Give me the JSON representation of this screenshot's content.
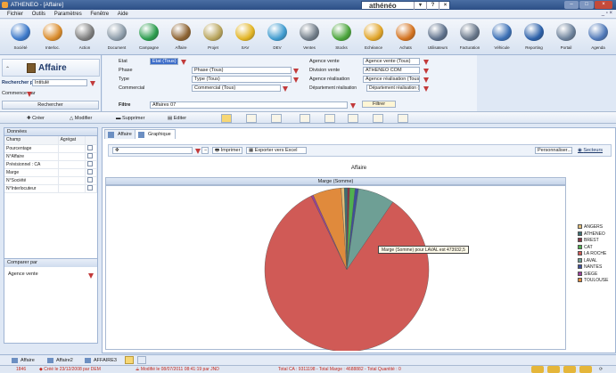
{
  "app": {
    "title": "ATHENEO - [Affaire]",
    "brand": "athénéo"
  },
  "menu": [
    "Fichier",
    "Outils",
    "Paramètres",
    "Fenêtre",
    "Aide"
  ],
  "toolbar": [
    {
      "label": "Société",
      "icon": "building-icon",
      "color": "#3b78c9"
    },
    {
      "label": "Interloc.",
      "icon": "people-icon",
      "color": "#d98b2b"
    },
    {
      "label": "Action",
      "icon": "action-icon",
      "color": "#7d7d7d"
    },
    {
      "label": "Document",
      "icon": "document-icon",
      "color": "#8b9aa8"
    },
    {
      "label": "Campagne",
      "icon": "campaign-icon",
      "color": "#2b9c4d"
    },
    {
      "label": "Affaire",
      "icon": "affaire-icon",
      "color": "#8d6332"
    },
    {
      "label": "Projet",
      "icon": "projet-icon",
      "color": "#b8a45c"
    },
    {
      "label": "SAV",
      "icon": "sav-icon",
      "color": "#e2b423"
    },
    {
      "label": "DEV",
      "icon": "dev-icon",
      "color": "#3f9bcf"
    },
    {
      "label": "Ventes",
      "icon": "ventes-icon",
      "color": "#6f7b87"
    },
    {
      "label": "Stocks",
      "icon": "stocks-icon",
      "color": "#4aa43a"
    },
    {
      "label": "Echéance",
      "icon": "echeance-icon",
      "color": "#e0a428"
    },
    {
      "label": "Achats",
      "icon": "achats-icon",
      "color": "#d3721f"
    },
    {
      "label": "Utilisateurs",
      "icon": "users-icon",
      "color": "#5c6f8a"
    },
    {
      "label": "Facturation",
      "icon": "facturation-icon",
      "color": "#657488"
    },
    {
      "label": "Véhicule",
      "icon": "vehicle-icon",
      "color": "#3b6fb5"
    },
    {
      "label": "Reporting",
      "icon": "reporting-icon",
      "color": "#2b5fa8"
    },
    {
      "label": "Portail",
      "icon": "portail-icon",
      "color": "#6a7f99"
    },
    {
      "label": "Agenda",
      "icon": "agenda-icon",
      "color": "#4f78b8"
    }
  ],
  "left": {
    "title": "Affaire",
    "rechercher_par_label": "Rechercher par",
    "rechercher_par_value": "Intitulé",
    "commence_par_label": "Commence par",
    "commence_par_value": "",
    "rechercher_button": "Rechercher"
  },
  "filters": {
    "etat_label": "Etat",
    "etat_value": "Etat (Tous)",
    "phase_label": "Phase",
    "phase_value": "Phase (Tous)",
    "type_label": "Type",
    "type_value": "Type (Tous)",
    "commercial_label": "Commercial",
    "commercial_value": "Commercial (Tous)",
    "agence_vente_label": "Agence vente",
    "agence_vente_value": "Agence vente (Tous)",
    "division_label": "Division vente",
    "division_value": "ATHENEO COM",
    "agence_real_label": "Agence réalisation",
    "agence_real_value": "Agence réalisation (Tous)",
    "dept_label": "Département réalisation",
    "dept_value": "Département réalisation (Tous)",
    "filtre_label": "Filtre",
    "filtre_value": "Affaires 07",
    "filtrer_button": "Filtrer"
  },
  "actions": {
    "creer": "Créer",
    "modifier": "Modifier",
    "supprimer": "Supprimer",
    "editer": "Editer"
  },
  "donnees": {
    "title": "Données",
    "col_champ": "Champ",
    "col_agregat": "Agrégat",
    "rows": [
      "Pourcentage",
      "N°Affaire",
      "Prévisionnel : CA",
      "Marge",
      "N°Société",
      "N°Interlocuteur"
    ]
  },
  "comparer": {
    "title": "Comparer par",
    "value": "Agence vente"
  },
  "tabs": {
    "affaire": "Affaire",
    "graphique": "Graphique"
  },
  "chart_toolbar": {
    "imprimer": "Imprimer",
    "exporter": "Exporter vers Excel",
    "personnaliser": "Personnaliser...",
    "secteurs": "Secteurs"
  },
  "chart_data": {
    "type": "pie",
    "title": "Affaire",
    "subtitle": "Marge (Somme)",
    "categories": [
      "ANGERS",
      "ATHENEO",
      "BREST",
      "CAT",
      "LA ROCHE",
      "LAVAL",
      "NANTES",
      "SIEGE",
      "TOULOUSE"
    ],
    "values": [
      3500,
      3500,
      2500,
      6000,
      473932.5,
      41000,
      3800,
      2500,
      32000
    ],
    "colors": [
      "#e4c07a",
      "#3b6f73",
      "#8a3344",
      "#50b050",
      "#d05a56",
      "#6e9f95",
      "#3e4f9a",
      "#9a3f9b",
      "#e08a3c"
    ],
    "legend": "right",
    "tooltip": "Marge (Somme) pour LAVAL est 473932,5"
  },
  "bottom_tabs": [
    "Affaire",
    "Affaire2",
    "AFFAIRE3"
  ],
  "status": {
    "count": "1846",
    "created": "Créé le 23/12/2008 par DEM",
    "modified": "Modifié le 08/07/2011 08:41:19 par JND",
    "totals": "Total CA : 9311198 - Total Marge : 4688882 - Total Quantité : 0"
  }
}
